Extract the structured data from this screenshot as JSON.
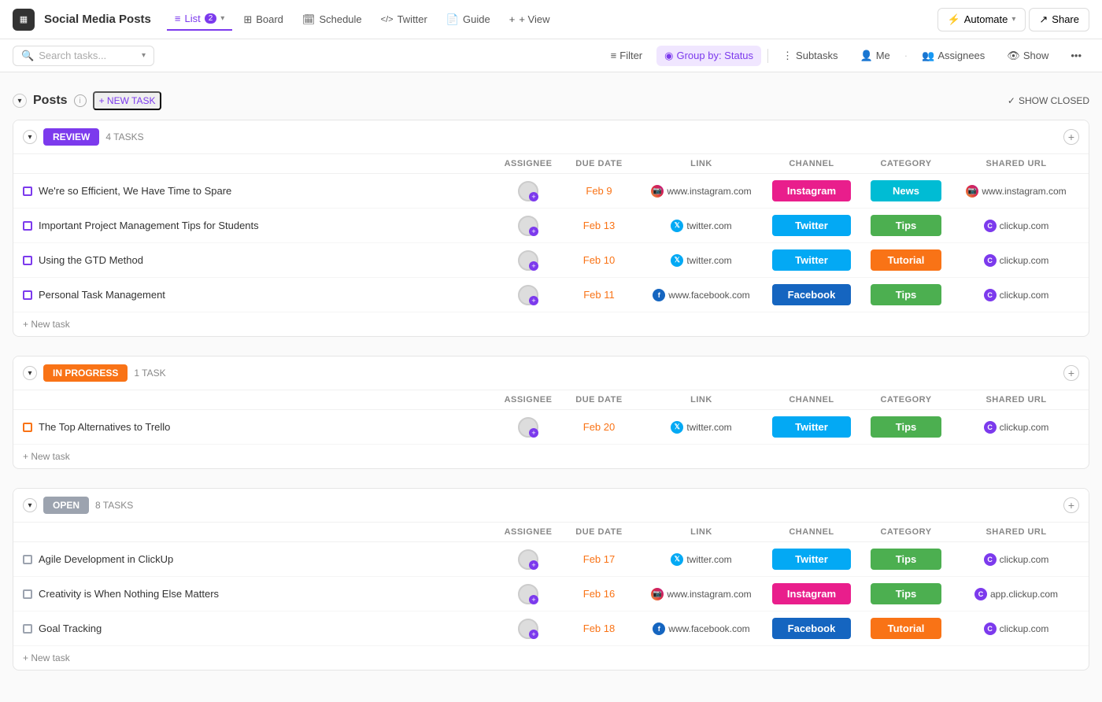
{
  "app": {
    "icon_text": "▦",
    "title": "Social Media Posts",
    "nav_tabs": [
      {
        "id": "list",
        "label": "List",
        "badge": "2",
        "active": true,
        "icon": "≡"
      },
      {
        "id": "board",
        "label": "Board",
        "active": false,
        "icon": "⊞"
      },
      {
        "id": "schedule",
        "label": "Schedule",
        "active": false,
        "icon": "📅"
      },
      {
        "id": "twitter",
        "label": "Twitter",
        "active": false,
        "icon": "</>"
      },
      {
        "id": "guide",
        "label": "Guide",
        "active": false,
        "icon": "📄"
      },
      {
        "id": "view",
        "label": "+ View",
        "active": false
      }
    ],
    "automate_label": "Automate",
    "share_label": "Share"
  },
  "toolbar": {
    "search_placeholder": "Search tasks...",
    "filter_label": "Filter",
    "group_by_label": "Group by: Status",
    "subtasks_label": "Subtasks",
    "me_label": "Me",
    "assignees_label": "Assignees",
    "show_label": "Show"
  },
  "posts_section": {
    "title": "Posts",
    "new_task_label": "+ NEW TASK",
    "show_closed_label": "SHOW CLOSED"
  },
  "groups": [
    {
      "id": "review",
      "label": "REVIEW",
      "style": "review",
      "count": "4 TASKS",
      "columns": [
        "ASSIGNEE",
        "DUE DATE",
        "LINK",
        "CHANNEL",
        "CATEGORY",
        "SHARED URL"
      ],
      "tasks": [
        {
          "name": "We're so Efficient, We Have Time to Spare",
          "checkbox_style": "purple",
          "due_date": "Feb 9",
          "link_icon": "ig",
          "link_text": "www.instagram.com",
          "channel": "Instagram",
          "channel_style": "instagram",
          "category": "News",
          "category_style": "news",
          "shared_icon": "ig",
          "shared_url": "www.instagram.com"
        },
        {
          "name": "Important Project Management Tips for Students",
          "checkbox_style": "purple",
          "due_date": "Feb 13",
          "link_icon": "tw",
          "link_text": "twitter.com",
          "channel": "Twitter",
          "channel_style": "twitter",
          "category": "Tips",
          "category_style": "tips",
          "shared_icon": "cu",
          "shared_url": "clickup.com"
        },
        {
          "name": "Using the GTD Method",
          "checkbox_style": "purple",
          "due_date": "Feb 10",
          "link_icon": "tw",
          "link_text": "twitter.com",
          "channel": "Twitter",
          "channel_style": "twitter",
          "category": "Tutorial",
          "category_style": "tutorial",
          "shared_icon": "cu",
          "shared_url": "clickup.com"
        },
        {
          "name": "Personal Task Management",
          "checkbox_style": "purple",
          "due_date": "Feb 11",
          "link_icon": "fb",
          "link_text": "www.facebook.com",
          "channel": "Facebook",
          "channel_style": "facebook",
          "category": "Tips",
          "category_style": "tips",
          "shared_icon": "cu",
          "shared_url": "clickup.com"
        }
      ],
      "new_task_label": "+ New task"
    },
    {
      "id": "in-progress",
      "label": "IN PROGRESS",
      "style": "in-progress",
      "count": "1 TASK",
      "columns": [
        "ASSIGNEE",
        "DUE DATE",
        "LINK",
        "CHANNEL",
        "CATEGORY",
        "SHARED URL"
      ],
      "tasks": [
        {
          "name": "The Top Alternatives to Trello",
          "checkbox_style": "orange",
          "due_date": "Feb 20",
          "link_icon": "tw",
          "link_text": "twitter.com",
          "channel": "Twitter",
          "channel_style": "twitter",
          "category": "Tips",
          "category_style": "tips",
          "shared_icon": "cu",
          "shared_url": "clickup.com"
        }
      ],
      "new_task_label": "+ New task"
    },
    {
      "id": "open",
      "label": "OPEN",
      "style": "open",
      "count": "8 TASKS",
      "columns": [
        "ASSIGNEE",
        "DUE DATE",
        "LINK",
        "CHANNEL",
        "CATEGORY",
        "SHARED URL"
      ],
      "tasks": [
        {
          "name": "Agile Development in ClickUp",
          "checkbox_style": "gray",
          "due_date": "Feb 17",
          "link_icon": "tw",
          "link_text": "twitter.com",
          "channel": "Twitter",
          "channel_style": "twitter",
          "category": "Tips",
          "category_style": "tips",
          "shared_icon": "cu",
          "shared_url": "clickup.com"
        },
        {
          "name": "Creativity is When Nothing Else Matters",
          "checkbox_style": "gray",
          "due_date": "Feb 16",
          "link_icon": "ig",
          "link_text": "www.instagram.com",
          "channel": "Instagram",
          "channel_style": "instagram",
          "category": "Tips",
          "category_style": "tips",
          "shared_icon": "cu",
          "shared_url": "app.clickup.com"
        },
        {
          "name": "Goal Tracking",
          "checkbox_style": "gray",
          "due_date": "Feb 18",
          "link_icon": "fb",
          "link_text": "www.facebook.com",
          "channel": "Facebook",
          "channel_style": "facebook",
          "category": "Tutorial",
          "category_style": "tutorial",
          "shared_icon": "cu",
          "shared_url": "clickup.com"
        }
      ],
      "new_task_label": "+ New task"
    }
  ],
  "icons": {
    "collapse": "▾",
    "expand": "▸",
    "search": "🔍",
    "filter": "≡",
    "chevron_down": "▾",
    "plus": "+",
    "check": "✓",
    "info": "i",
    "share": "↗",
    "automate": "⚡",
    "more": "•••"
  }
}
